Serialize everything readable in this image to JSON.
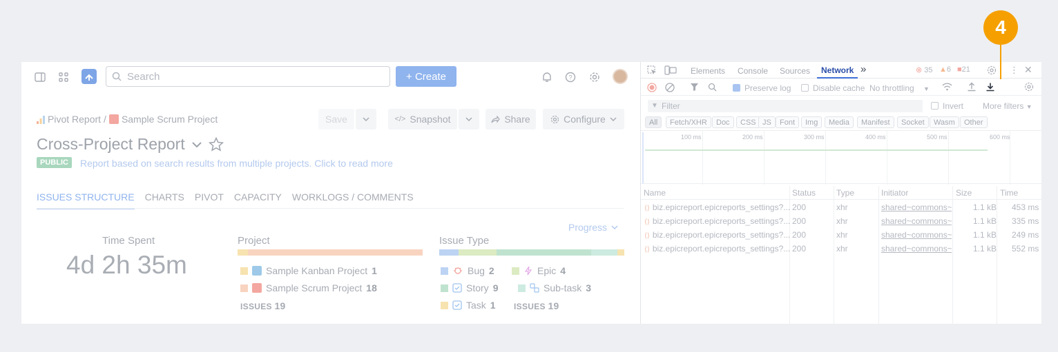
{
  "app": {
    "topbar": {
      "search_placeholder": "Search",
      "create_label": "+ Create"
    },
    "breadcrumb": {
      "root": "Pivot Report",
      "separator": "/",
      "project": "Sample Scrum Project"
    },
    "toolbar": {
      "save": "Save",
      "snapshot": "Snapshot",
      "share": "Share",
      "configure": "Configure"
    },
    "title": "Cross-Project Report",
    "badge": "PUBLIC",
    "description": "Report based on search results from multiple projects. Click to read more",
    "tabs": [
      "ISSUES STRUCTURE",
      "CHARTS",
      "PIVOT",
      "CAPACITY",
      "WORKLOGS / COMMENTS"
    ],
    "active_tab": "ISSUES STRUCTURE",
    "progress_dropdown": "Progress",
    "time_spent": {
      "label": "Time Spent",
      "value": "4d 2h 35m"
    },
    "project_section": {
      "title": "Project",
      "items": [
        {
          "name": "Sample Kanban Project",
          "count": "1"
        },
        {
          "name": "Sample Scrum Project",
          "count": "18"
        }
      ],
      "issues_label": "ISSUES",
      "issues_total": "19"
    },
    "issue_type_section": {
      "title": "Issue Type",
      "items": [
        {
          "name": "Bug",
          "count": "2"
        },
        {
          "name": "Epic",
          "count": "4"
        },
        {
          "name": "Story",
          "count": "9"
        },
        {
          "name": "Sub-task",
          "count": "3"
        },
        {
          "name": "Task",
          "count": "1"
        }
      ],
      "issues_label": "ISSUES",
      "issues_total": "19"
    },
    "colors": {
      "accent": "#8fb4ee",
      "bug": "#a9c4f0",
      "epic": "#cfe3b0",
      "story": "#a8d7bd",
      "subtask": "#bfe0d4",
      "task": "#f7e3b0",
      "kanban": "#f7e3b0",
      "scrum": "#f8c9b0"
    }
  },
  "devtools": {
    "tabs": [
      "Elements",
      "Console",
      "Sources",
      "Network"
    ],
    "active_tab": "Network",
    "more_tabs": "»",
    "errors": "35",
    "warnings": "6",
    "messages": "21",
    "toolbar": {
      "preserve_log": "Preserve log",
      "disable_cache": "Disable cache",
      "throttling": "No throttling"
    },
    "filter_placeholder": "Filter",
    "invert": "Invert",
    "more_filters": "More filters",
    "type_filters": [
      "All",
      "Fetch/XHR",
      "Doc",
      "CSS",
      "JS",
      "Font",
      "Img",
      "Media",
      "Manifest",
      "Socket",
      "Wasm",
      "Other"
    ],
    "timeline_ticks": [
      "100 ms",
      "200 ms",
      "300 ms",
      "400 ms",
      "500 ms",
      "600 ms"
    ],
    "columns": [
      "Name",
      "Status",
      "Type",
      "Initiator",
      "Size",
      "Time"
    ],
    "requests": [
      {
        "name": "biz.epicreport.epicreports_settings?...",
        "status": "200",
        "type": "xhr",
        "initiator": "shared~commons~a",
        "size": "1.1 kB",
        "time": "453 ms"
      },
      {
        "name": "biz.epicreport.epicreports_settings?...",
        "status": "200",
        "type": "xhr",
        "initiator": "shared~commons~a",
        "size": "1.1 kB",
        "time": "335 ms"
      },
      {
        "name": "biz.epicreport.epicreports_settings?...",
        "status": "200",
        "type": "xhr",
        "initiator": "shared~commons~a",
        "size": "1.1 kB",
        "time": "249 ms"
      },
      {
        "name": "biz.epicreport.epicreports_settings?...",
        "status": "200",
        "type": "xhr",
        "initiator": "shared~commons~a",
        "size": "1.1 kB",
        "time": "552 ms"
      }
    ]
  },
  "callout": {
    "number": "4",
    "target": "download-icon",
    "color": "#f5a000"
  }
}
